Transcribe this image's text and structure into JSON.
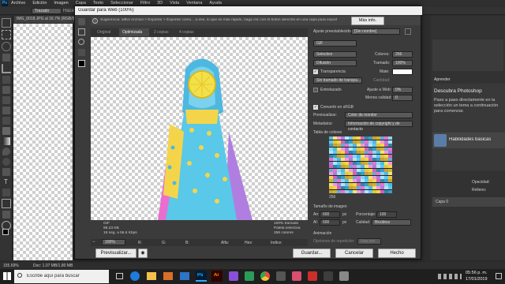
{
  "ps": {
    "menu": [
      "Archivo",
      "Edición",
      "Imagen",
      "Capa",
      "Texto",
      "Seleccionar",
      "Filtro",
      "3D",
      "Vista",
      "Ventana",
      "Ayuda"
    ],
    "options_bar": {
      "mode": "Trazado",
      "extra": "Hacer"
    },
    "doc_tab": "IMG_6018.JPG al 16.7% (RGB/8*)",
    "status_left": "155.69%",
    "status_doc": "Doc: 1.07 MB/1.80 MB",
    "right_panel": {
      "title": "Aprender",
      "learn_heading": "Descubra Photoshop",
      "learn_text": "Paso a paso directamente en la selección un tema a continuación para comenzar.",
      "topic": "Habilidades básicas",
      "opacity_label": "Opacidad:",
      "fill_label": "Relleno:",
      "layer": "Capa 0"
    }
  },
  "dialog": {
    "title": "Guardar para Web (100%)",
    "tip": "Sugerencia: altKe Archivo > Exportar > Exportar como... a ese, lo que es más rápido, haga clic con el botón derecho en una capa para exportar los recursos.",
    "more_info": "Más info.",
    "tabs": [
      "Original",
      "Optimizada",
      "2 copias",
      "4 copias"
    ],
    "preview_info": {
      "format": "GIF",
      "size": "96.23 KB",
      "time": "18 seg. a 56.6 Kbps",
      "dither": "100% tramado",
      "palette": "Paleta selectiva",
      "colors": "256 colores"
    },
    "bottom_bar": {
      "zoom": "100%",
      "r": "R:",
      "g": "G:",
      "b": "B:",
      "alfa": "Alfa:",
      "hex": "Hex:",
      "indice": "Índice:"
    },
    "settings": {
      "preset_label": "Ajuste preestablecido:",
      "preset_value": "[Sin nombre]",
      "format": "GIF",
      "reduction": "Selectivo",
      "colors_label": "Colores:",
      "colors_value": "256",
      "dither_algo": "Difusión",
      "dither_label": "Tramado:",
      "dither_value": "100%",
      "transparency_label": "Transparencia",
      "matte_label": "Mate:",
      "transparency_dither": "Sin tramado de transpa...",
      "amount_label": "Cantidad:",
      "interlaced_label": "Entrelazado",
      "web_snap_label": "Ajuste a Web:",
      "web_snap_value": "0%",
      "lossy_label": "Menos calidad:",
      "lossy_value": "0",
      "convert_srgb": "Convertir en sRGB",
      "preview_label": "Previsualizar:",
      "preview_value": "Color de monitor",
      "metadata_label": "Metadatos:",
      "metadata_value": "Información de copyright y de contacto",
      "color_table_label": "Tabla de colores",
      "color_count": "256",
      "image_size_label": "Tamaño de imagen",
      "w_label": "An:",
      "w_value": "600",
      "h_label": "Al:",
      "h_value": "600",
      "px": "px",
      "percent_label": "Porcentaje:",
      "percent_value": "100",
      "quality_label": "Calidad:",
      "quality_value": "Bicúbica",
      "animation_label": "Animación",
      "loop_label": "Opciones de repetición:",
      "loop_value": "Una vez"
    },
    "buttons": {
      "preview": "Previsualizar...",
      "save": "Guardar...",
      "cancel": "Cancelar",
      "done": "Hecho"
    }
  },
  "taskbar": {
    "search_placeholder": "Escribe aquí para buscar",
    "time": "05:56 p. m.",
    "date": "17/01/2019",
    "ps_label": "Ps",
    "ai_label": "Ai"
  },
  "colors": {
    "accent": "#31a8ff",
    "dialog_bg": "#3b3b3b",
    "taskbar": "#1f1f1f"
  }
}
